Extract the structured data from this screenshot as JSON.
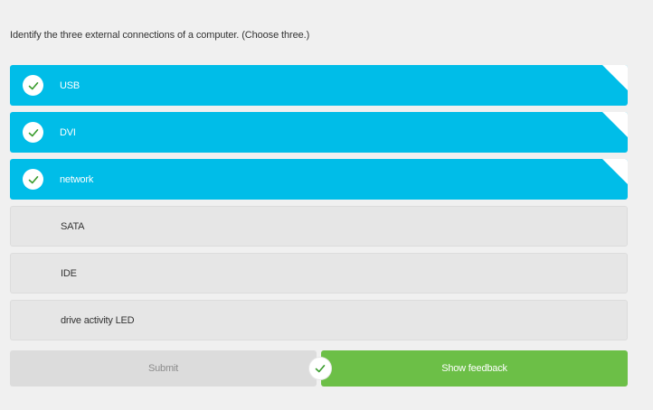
{
  "question": {
    "text": "Identify the three external connections of a computer. (Choose three.)"
  },
  "options": [
    {
      "label": "USB",
      "selected": true
    },
    {
      "label": "DVI",
      "selected": true
    },
    {
      "label": "network",
      "selected": true
    },
    {
      "label": "SATA",
      "selected": false
    },
    {
      "label": "IDE",
      "selected": false
    },
    {
      "label": "drive activity LED",
      "selected": false
    }
  ],
  "actions": {
    "submit_label": "Submit",
    "feedback_label": "Show feedback"
  },
  "colors": {
    "selected_bg": "#00bde8",
    "unselected_bg": "#e6e6e6",
    "check_green": "#3c9d2f",
    "feedback_bg": "#6cbf47",
    "submit_bg": "#dcdcdc"
  },
  "icons": {
    "option_check": "check-icon",
    "result_check": "check-icon"
  }
}
